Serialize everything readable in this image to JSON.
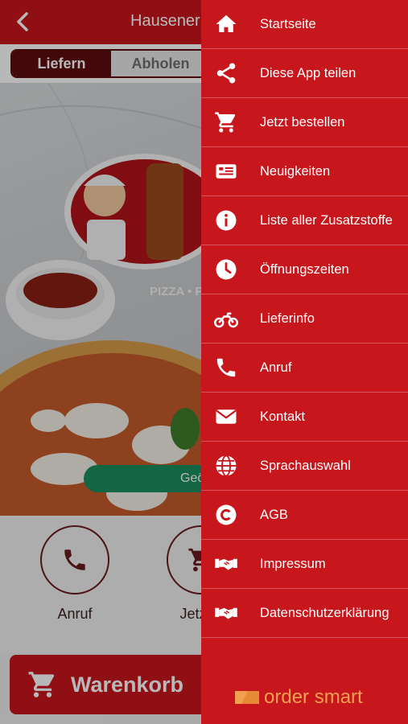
{
  "header": {
    "title": "Hausener"
  },
  "tabs": {
    "deliver_label": "Liefern",
    "pickup_label": "Abholen"
  },
  "hero": {
    "logo_text": "PIZZA • P",
    "status_text": "Geö"
  },
  "actions": {
    "call_label": "Anruf",
    "order_label": "Jetzt b"
  },
  "cart": {
    "label": "Warenkorb"
  },
  "menu": {
    "items": [
      {
        "label": "Startseite",
        "icon": "home-icon"
      },
      {
        "label": "Diese App teilen",
        "icon": "share-icon"
      },
      {
        "label": "Jetzt bestellen",
        "icon": "cart-icon"
      },
      {
        "label": "Neuigkeiten",
        "icon": "news-icon"
      },
      {
        "label": "Liste aller Zusatzstoffe",
        "icon": "info-icon"
      },
      {
        "label": "Öffnungszeiten",
        "icon": "clock-icon"
      },
      {
        "label": "Lieferinfo",
        "icon": "motorbike-icon"
      },
      {
        "label": "Anruf",
        "icon": "phone-icon"
      },
      {
        "label": "Kontakt",
        "icon": "mail-icon"
      },
      {
        "label": "Sprachauswahl",
        "icon": "globe-icon"
      },
      {
        "label": "AGB",
        "icon": "copyright-icon"
      },
      {
        "label": "Impressum",
        "icon": "handshake-icon"
      },
      {
        "label": "Datenschutzerklärung",
        "icon": "handshake-icon"
      }
    ]
  },
  "brand": {
    "name": "order smart"
  },
  "colors": {
    "primary": "#c8161d",
    "dark": "#5c0c0f",
    "status_green": "#1a8e5f",
    "brand_orange": "#f0a050"
  }
}
